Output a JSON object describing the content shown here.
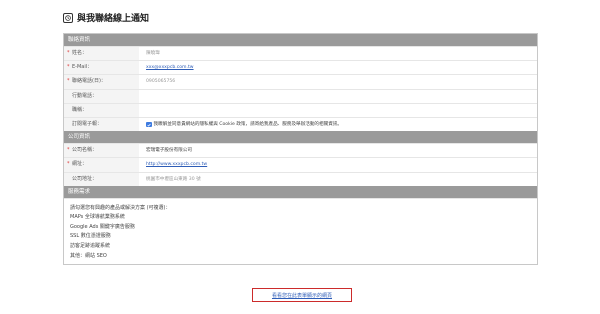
{
  "title": "與我聯絡線上通知",
  "sections": {
    "contact": {
      "header": "聯絡資訊",
      "fields": [
        {
          "label": "姓名：",
          "value": "陳曉瑋",
          "required": true
        },
        {
          "label": "E-Mail：",
          "value": "xxx@xxxpcb.com.tw",
          "required": true
        },
        {
          "label": "聯絡電話(日)：",
          "value": "0905065756",
          "required": true
        },
        {
          "label": "行動電話：",
          "value": "",
          "required": false
        },
        {
          "label": "職稱：",
          "value": "",
          "required": false
        },
        {
          "label": "訂閱電子報：",
          "value": "我瞭解並同意貴網站的隱私權與 Cookie 政策，請寄給我產品、服務及舉辦活動的相關資訊。",
          "required": false
        }
      ]
    },
    "company": {
      "header": "公司資訊",
      "fields": [
        {
          "label": "公司名稱：",
          "value": "宏瑞電子股份有限公司",
          "required": true
        },
        {
          "label": "網址：",
          "value": "http://www.xxxpcb.com.tw",
          "required": true
        },
        {
          "label": "公司地址：",
          "value": "桃園市中壢區山東路 30 號",
          "required": false
        }
      ]
    },
    "services": {
      "header": "服務需求",
      "intro": "請勾選您有興趣的產品或解決方案 (可複選)：",
      "items": [
        "MAPs 全球導航業務系統",
        "Google Ads 關鍵字廣告服務",
        "SSL 數位憑證服務",
        "訪客足跡追蹤系統",
        "其他：網站 SEO"
      ]
    }
  },
  "footer_link": "看看您在此表單顯示的網頁",
  "colors": {
    "section_bg": "#9a9a9a",
    "link": "#2e5db7",
    "highlight_border": "#cc2b2b",
    "checkbox": "#3e7be0",
    "required": "#d33333"
  }
}
